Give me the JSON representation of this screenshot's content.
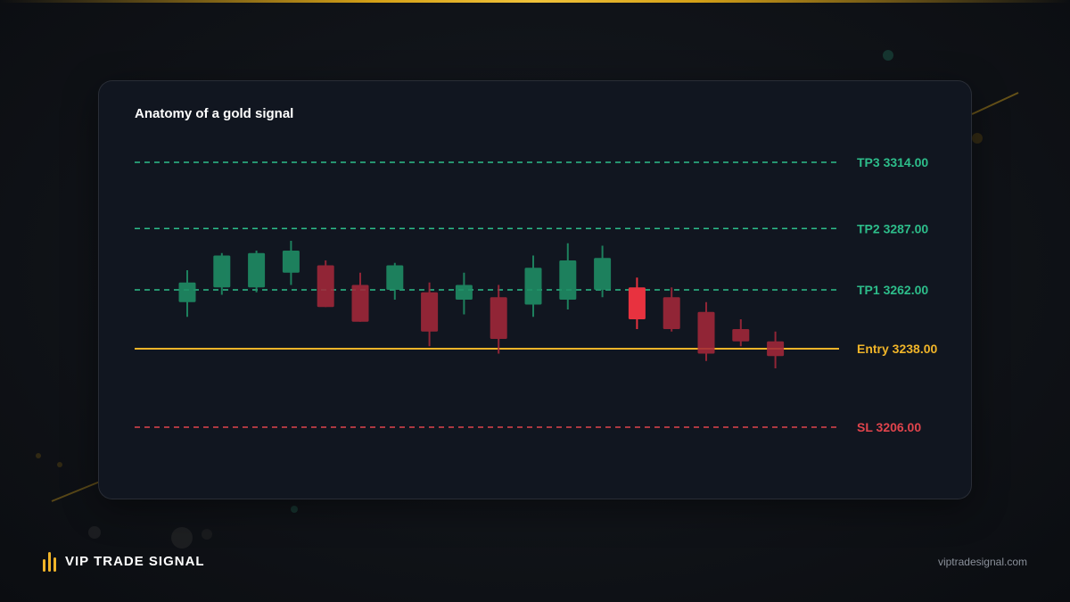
{
  "title": "Anatomy of a gold signal",
  "brand": {
    "name": "VIP TRADE SIGNAL",
    "url": "viptradesignal.com"
  },
  "colors": {
    "gold": "#f0b429",
    "tp": "#2dbd8a",
    "sl": "#e0444c",
    "bull": "#1f8f66",
    "bear": "#a3283a"
  },
  "chart_data": {
    "type": "candlestick",
    "title": "Anatomy of a gold signal",
    "ylim": [
      3190,
      3330
    ],
    "levels": [
      {
        "name": "TP3",
        "value": 3314.0,
        "label": "TP3 3314.00",
        "style": "dashed",
        "color": "#2dbd8a"
      },
      {
        "name": "TP2",
        "value": 3287.0,
        "label": "TP2 3287.00",
        "style": "dashed",
        "color": "#2dbd8a"
      },
      {
        "name": "TP1",
        "value": 3262.0,
        "label": "TP1 3262.00",
        "style": "dashed",
        "color": "#2dbd8a"
      },
      {
        "name": "Entry",
        "value": 3238.0,
        "label": "Entry 3238.00",
        "style": "solid",
        "color": "#f0b429"
      },
      {
        "name": "SL",
        "value": 3206.0,
        "label": "SL 3206.00",
        "style": "dashed",
        "color": "#e0444c"
      }
    ],
    "candles": [
      {
        "open": 3257,
        "high": 3270,
        "low": 3251,
        "close": 3265
      },
      {
        "open": 3263,
        "high": 3277,
        "low": 3260,
        "close": 3276
      },
      {
        "open": 3263,
        "high": 3278,
        "low": 3261,
        "close": 3277
      },
      {
        "open": 3269,
        "high": 3282,
        "low": 3264,
        "close": 3278
      },
      {
        "open": 3272,
        "high": 3274,
        "low": 3255,
        "close": 3255
      },
      {
        "open": 3264,
        "high": 3269,
        "low": 3249,
        "close": 3249
      },
      {
        "open": 3262,
        "high": 3273,
        "low": 3258,
        "close": 3272
      },
      {
        "open": 3261,
        "high": 3265,
        "low": 3239,
        "close": 3245
      },
      {
        "open": 3258,
        "high": 3269,
        "low": 3252,
        "close": 3264
      },
      {
        "open": 3259,
        "high": 3264,
        "low": 3236,
        "close": 3242
      },
      {
        "open": 3256,
        "high": 3276,
        "low": 3251,
        "close": 3271
      },
      {
        "open": 3258,
        "high": 3281,
        "low": 3254,
        "close": 3274
      },
      {
        "open": 3262,
        "high": 3280,
        "low": 3259,
        "close": 3275
      },
      {
        "open": 3263,
        "high": 3267,
        "low": 3246,
        "close": 3250
      },
      {
        "open": 3259,
        "high": 3263,
        "low": 3245,
        "close": 3246
      },
      {
        "open": 3253,
        "high": 3257,
        "low": 3233,
        "close": 3236
      },
      {
        "open": 3246,
        "high": 3250,
        "low": 3239,
        "close": 3241
      },
      {
        "open": 3241,
        "high": 3245,
        "low": 3230,
        "close": 3235
      }
    ]
  }
}
